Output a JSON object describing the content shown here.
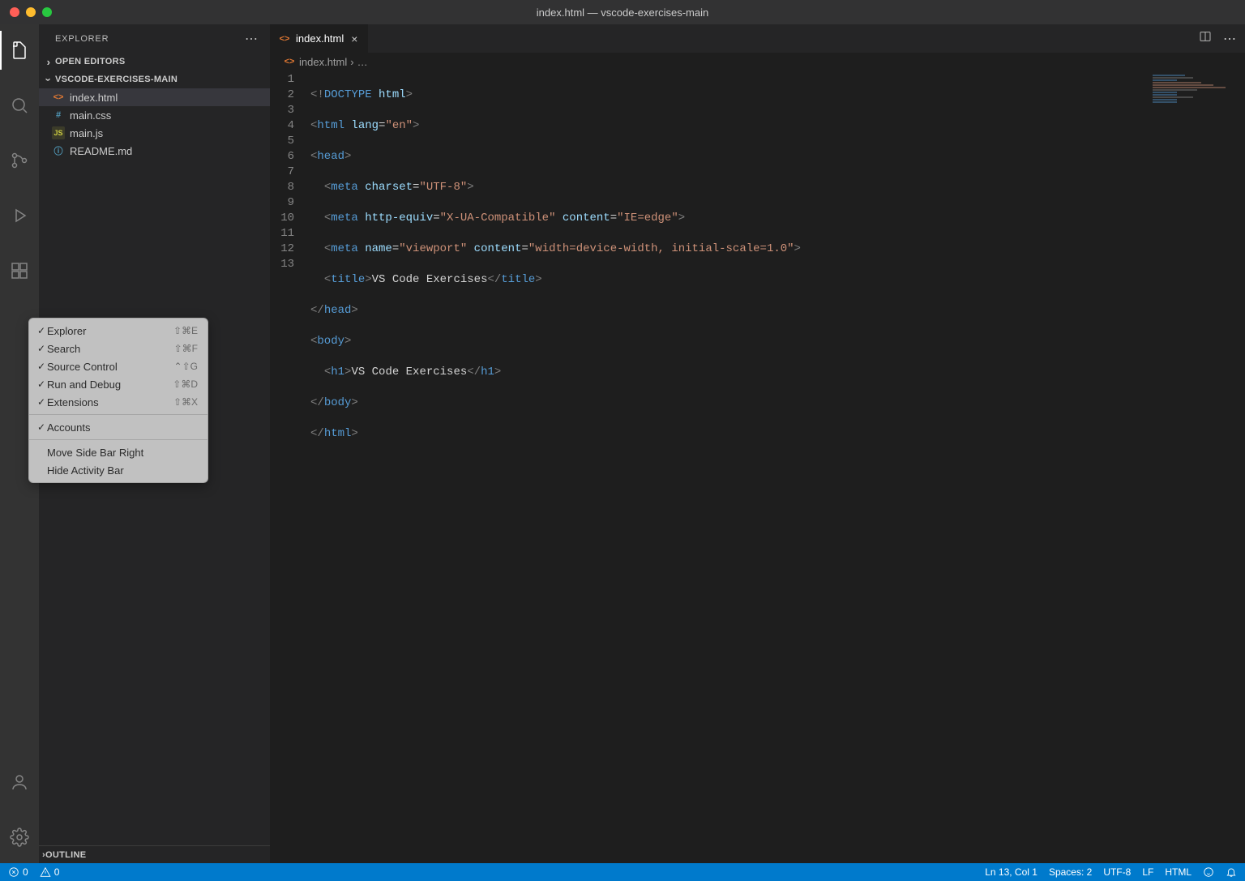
{
  "window": {
    "title": "index.html — vscode-exercises-main"
  },
  "sidebar": {
    "header": "EXPLORER",
    "open_editors": "OPEN EDITORS",
    "folder": "VSCODE-EXERCISES-MAIN",
    "files": [
      {
        "name": "index.html",
        "icon": "html",
        "selected": true
      },
      {
        "name": "main.css",
        "icon": "css",
        "selected": false
      },
      {
        "name": "main.js",
        "icon": "js",
        "selected": false
      },
      {
        "name": "README.md",
        "icon": "info",
        "selected": false
      }
    ],
    "outline": "OUTLINE"
  },
  "tab": {
    "label": "index.html"
  },
  "breadcrumb": {
    "file": "index.html",
    "rest": "…"
  },
  "gutter": [
    "1",
    "2",
    "3",
    "4",
    "5",
    "6",
    "7",
    "8",
    "9",
    "10",
    "11",
    "12",
    "13"
  ],
  "code": {
    "l1": {
      "a": "<!",
      "b": "DOCTYPE",
      "c": " html",
      "d": ">"
    },
    "l2": {
      "a": "<",
      "b": "html",
      "c": " lang",
      "d": "=",
      "e": "\"en\"",
      "f": ">"
    },
    "l3": {
      "a": "<",
      "b": "head",
      "c": ">"
    },
    "l4": {
      "a": "<",
      "b": "meta",
      "c": " charset",
      "d": "=",
      "e": "\"UTF-8\"",
      "f": ">"
    },
    "l5": {
      "a": "<",
      "b": "meta",
      "c": " http-equiv",
      "d": "=",
      "e": "\"X-UA-Compatible\"",
      "f": " content",
      "g": "=",
      "h": "\"IE=edge\"",
      "i": ">"
    },
    "l6": {
      "a": "<",
      "b": "meta",
      "c": " name",
      "d": "=",
      "e": "\"viewport\"",
      "f": " content",
      "g": "=",
      "h": "\"width=device-width, initial-scale=1.0\"",
      "i": ">"
    },
    "l7": {
      "a": "<",
      "b": "title",
      "c": ">",
      "d": "VS Code Exercises",
      "e": "</",
      "f": "title",
      "g": ">"
    },
    "l8": {
      "a": "</",
      "b": "head",
      "c": ">"
    },
    "l9": {
      "a": "<",
      "b": "body",
      "c": ">"
    },
    "l10": {
      "a": "<",
      "b": "h1",
      "c": ">",
      "d": "VS Code Exercises",
      "e": "</",
      "f": "h1",
      "g": ">"
    },
    "l11": {
      "a": "</",
      "b": "body",
      "c": ">"
    },
    "l12": {
      "a": "</",
      "b": "html",
      "c": ">"
    }
  },
  "context_menu": {
    "items": [
      {
        "label": "Explorer",
        "checked": true,
        "shortcut": "⇧⌘E"
      },
      {
        "label": "Search",
        "checked": true,
        "shortcut": "⇧⌘F"
      },
      {
        "label": "Source Control",
        "checked": true,
        "shortcut": "⌃⇧G"
      },
      {
        "label": "Run and Debug",
        "checked": true,
        "shortcut": "⇧⌘D"
      },
      {
        "label": "Extensions",
        "checked": true,
        "shortcut": "⇧⌘X"
      }
    ],
    "accounts": "Accounts",
    "move": "Move Side Bar Right",
    "hide": "Hide Activity Bar"
  },
  "status": {
    "errors": "0",
    "warnings": "0",
    "lncol": "Ln 13, Col 1",
    "spaces": "Spaces: 2",
    "encoding": "UTF-8",
    "eol": "LF",
    "lang": "HTML"
  }
}
